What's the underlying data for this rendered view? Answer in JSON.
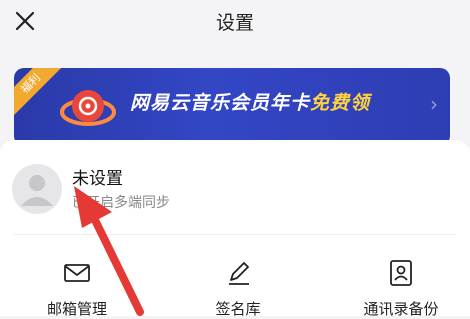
{
  "header": {
    "title": "设置",
    "close_icon": "close-icon"
  },
  "banner": {
    "tag": "福利",
    "text_main": "网易云音乐会员年卡",
    "text_highlight": "免费领"
  },
  "account": {
    "name": "未设置",
    "hint": "已开启多端同步"
  },
  "quick_actions": [
    {
      "label": "邮箱管理",
      "icon": "mail-icon"
    },
    {
      "label": "签名库",
      "icon": "pen-icon"
    },
    {
      "label": "通讯录备份",
      "icon": "contact-backup-icon"
    }
  ],
  "colors": {
    "banner_bg": "#3346c5",
    "banner_highlight": "#ffd23f",
    "annotation_arrow": "#e53935"
  }
}
